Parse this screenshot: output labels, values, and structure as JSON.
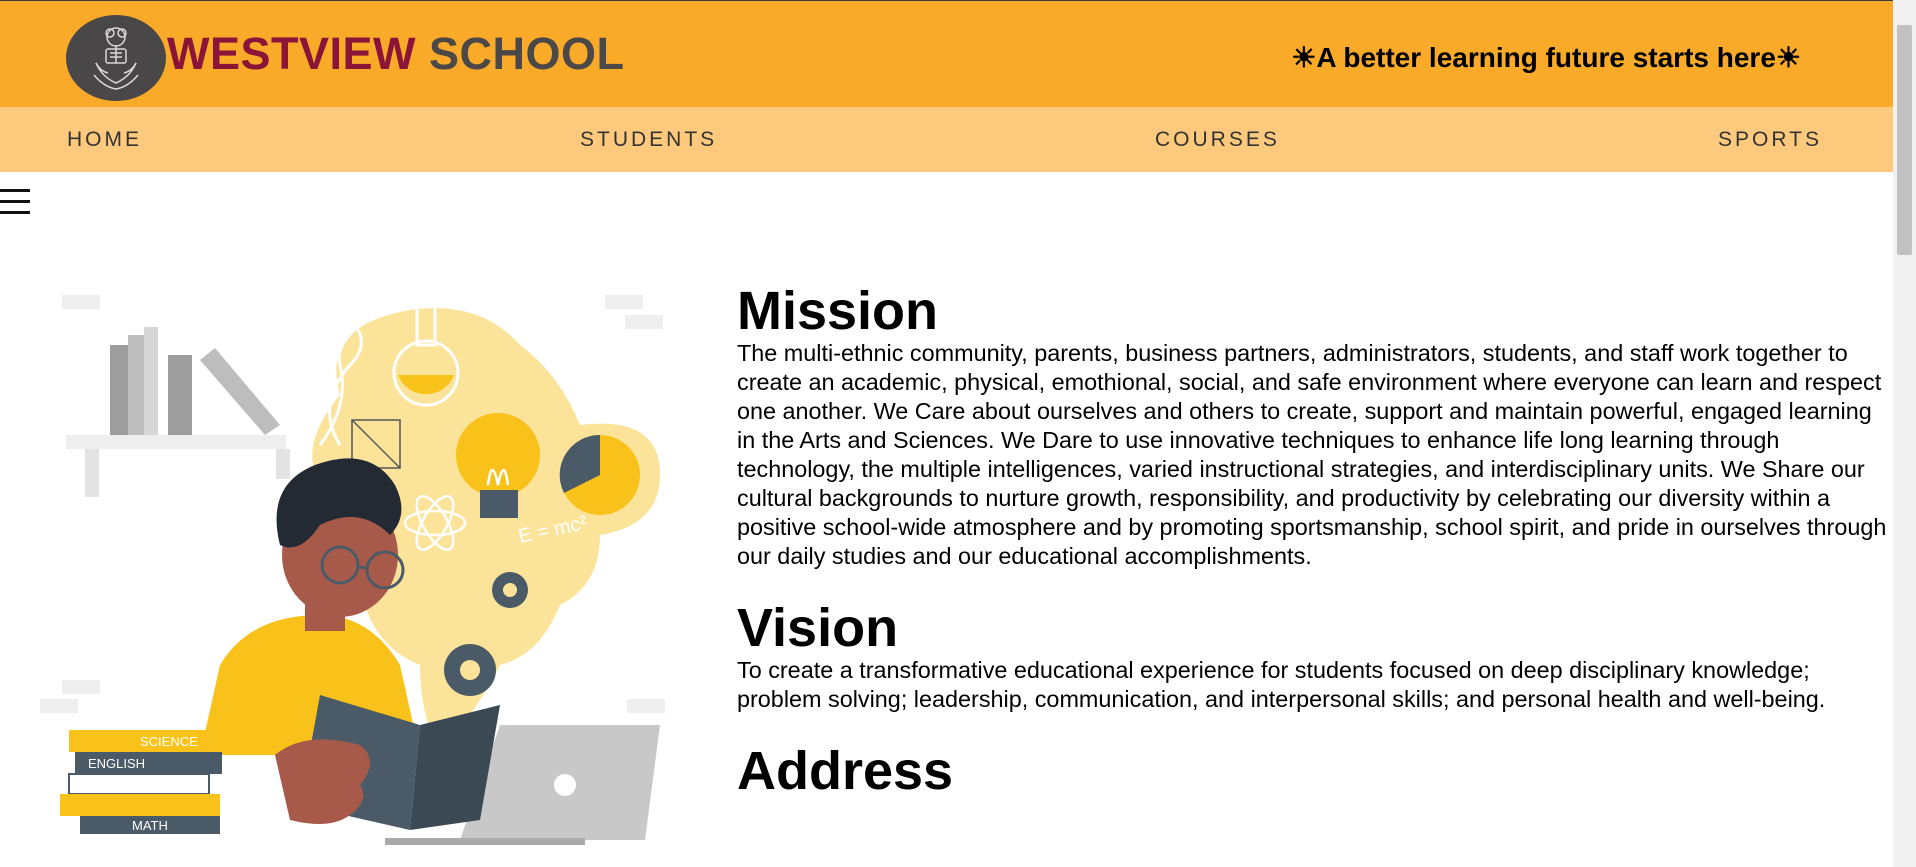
{
  "header": {
    "brand_word1": "WESTVIEW",
    "brand_word2": "SCHOOL",
    "tagline": "☀A better learning future starts here☀"
  },
  "nav": {
    "items": [
      "HOME",
      "STUDENTS",
      "COURSES",
      "SPORTS"
    ]
  },
  "menu_icon": "hamburger-menu-icon",
  "mission": {
    "title": "Mission",
    "text": "The multi-ethnic community, parents, business partners, administrators, students, and staff work together to create an academic, physical, emothional, social, and safe environment where everyone can learn and respect one another. We Care about ourselves and others to create, support and maintain powerful, engaged learning in the Arts and Sciences. We Dare to use innovative techniques to enhance life long learning through technology, the multiple intelligences, varied instructional strategies, and interdisciplinary units. We Share our cultural backgrounds to nurture growth, responsibility, and productivity by celebrating our diversity within a positive school-wide atmosphere and by promoting sportsmanship, school spirit, and pride in ourselves through our daily studies and our educational accomplishments."
  },
  "vision": {
    "title": "Vision",
    "text": "To create a transformative educational experience for students focused on deep disciplinary knowledge; problem solving; leadership, communication, and interpersonal skills; and personal health and well-being."
  },
  "address": {
    "title": "Address"
  },
  "illustration": {
    "book_labels": [
      "SCIENCE",
      "ENGLISH",
      "MATH"
    ],
    "formula": "E = mc²"
  },
  "colors": {
    "header_bg": "#f9aa28",
    "nav_bg": "#fdc97c",
    "brand_primary": "#8a1538",
    "brand_secondary": "#4b4847"
  }
}
